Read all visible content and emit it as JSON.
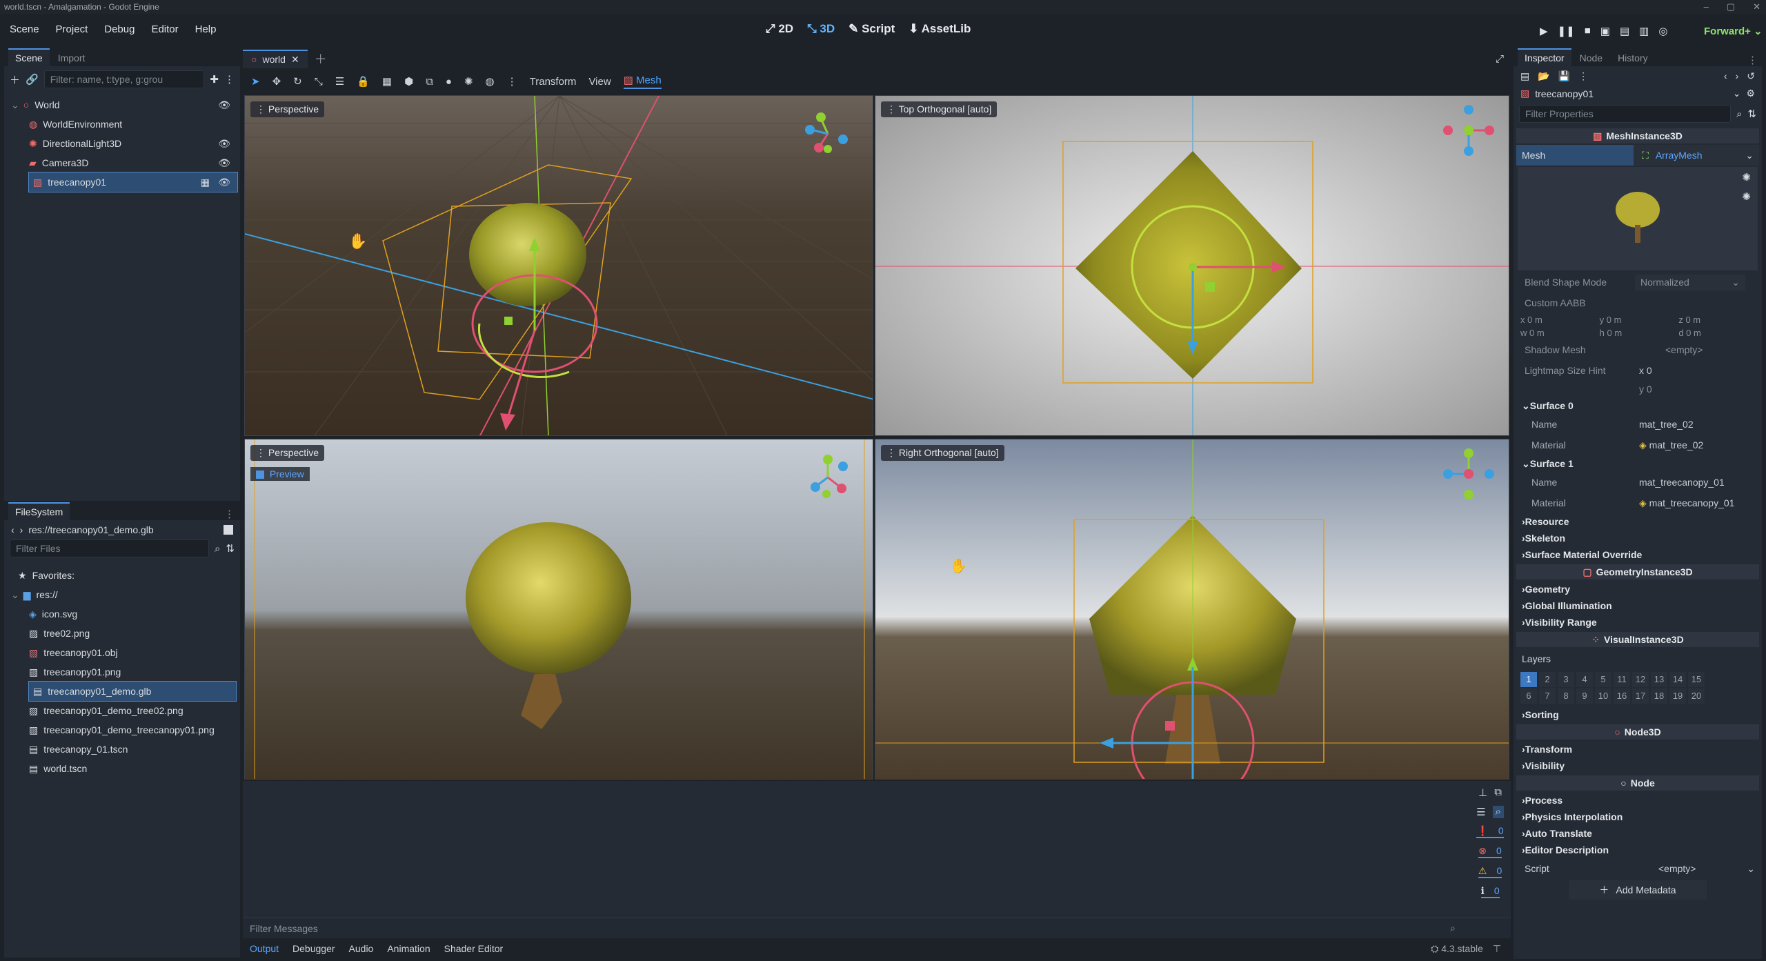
{
  "window": {
    "title": "world.tscn - Amalgamation - Godot Engine"
  },
  "menubar": {
    "menus": [
      "Scene",
      "Project",
      "Debug",
      "Editor",
      "Help"
    ],
    "workspaces": [
      "2D",
      "3D",
      "Script",
      "AssetLib"
    ],
    "active_workspace": "3D",
    "renderer": "Forward+"
  },
  "scene_dock": {
    "tabs": [
      "Scene",
      "Import"
    ],
    "filter_placeholder": "Filter: name, t:type, g:grou",
    "nodes": [
      {
        "name": "World",
        "icon": "node3d-icon",
        "depth": 0,
        "visible_toggle": true
      },
      {
        "name": "WorldEnvironment",
        "icon": "world-environment-icon",
        "depth": 1,
        "visible_toggle": false
      },
      {
        "name": "DirectionalLight3D",
        "icon": "light-icon",
        "depth": 1,
        "visible_toggle": true
      },
      {
        "name": "Camera3D",
        "icon": "camera-icon",
        "depth": 1,
        "visible_toggle": true
      },
      {
        "name": "treecanopy01",
        "icon": "mesh-instance-icon",
        "depth": 1,
        "visible_toggle": true,
        "selected": true
      }
    ]
  },
  "filesystem": {
    "tab": "FileSystem",
    "path": "res://treecanopy01_demo.glb",
    "filter_placeholder": "Filter Files",
    "favorites_label": "Favorites:",
    "root_label": "res://",
    "files": [
      {
        "name": "icon.svg",
        "icon": "svg-file-icon"
      },
      {
        "name": "tree02.png",
        "icon": "image-file-icon"
      },
      {
        "name": "treecanopy01.obj",
        "icon": "mesh-file-icon"
      },
      {
        "name": "treecanopy01.png",
        "icon": "image-file-icon"
      },
      {
        "name": "treecanopy01_demo.glb",
        "icon": "scene-file-icon",
        "selected": true
      },
      {
        "name": "treecanopy01_demo_tree02.png",
        "icon": "image-file-icon"
      },
      {
        "name": "treecanopy01_demo_treecanopy01.png",
        "icon": "image-file-icon"
      },
      {
        "name": "treecanopy_01.tscn",
        "icon": "scene-file-icon"
      },
      {
        "name": "world.tscn",
        "icon": "scene-file-icon"
      }
    ]
  },
  "editor": {
    "tab": "world",
    "toolbar": {
      "transform": "Transform",
      "view": "View",
      "mesh": "Mesh"
    },
    "viewports": [
      {
        "label": "Perspective"
      },
      {
        "label": "Top Orthogonal [auto]"
      },
      {
        "label": "Perspective",
        "preview": "Preview"
      },
      {
        "label": "Right Orthogonal [auto]"
      }
    ]
  },
  "bottom_panel": {
    "filter_placeholder": "Filter Messages",
    "tabs": [
      "Output",
      "Debugger",
      "Audio",
      "Animation",
      "Shader Editor"
    ],
    "active_tab": "Output",
    "counts": [
      "0",
      "0",
      "0",
      "0"
    ],
    "version": "4.3.stable"
  },
  "inspector": {
    "tabs": [
      "Inspector",
      "Node",
      "History"
    ],
    "object": "treecanopy01",
    "filter_placeholder": "Filter Properties",
    "class_mesh": "MeshInstance3D",
    "mesh_label": "Mesh",
    "mesh_value": "ArrayMesh",
    "blend_label": "Blend Shape Mode",
    "blend_value": "Normalized",
    "custom_aabb": "Custom AABB",
    "aabb": {
      "x": "0 m",
      "y": "0 m",
      "z": "0 m",
      "w": "0 m",
      "h": "0 m",
      "d": "0 m"
    },
    "shadow_label": "Shadow Mesh",
    "shadow_value": "<empty>",
    "lightmap_label": "Lightmap Size Hint",
    "lightmap_x": "0",
    "lightmap_y": "0",
    "surface0": {
      "title": "Surface 0",
      "name_label": "Name",
      "name": "mat_tree_02",
      "material_label": "Material",
      "material": "mat_tree_02"
    },
    "surface1": {
      "title": "Surface 1",
      "name_label": "Name",
      "name": "mat_treecanopy_01",
      "material_label": "Material",
      "material": "mat_treecanopy_01"
    },
    "resource": "Resource",
    "skeleton": "Skeleton",
    "surface_override": "Surface Material Override",
    "class_geometry": "GeometryInstance3D",
    "geometry": "Geometry",
    "gi": "Global Illumination",
    "vis_range": "Visibility Range",
    "class_visual": "VisualInstance3D",
    "layers_label": "Layers",
    "layers_top": [
      "1",
      "2",
      "3",
      "4",
      "5",
      "11",
      "12",
      "13",
      "14",
      "15"
    ],
    "layers_bottom": [
      "6",
      "7",
      "8",
      "9",
      "10",
      "16",
      "17",
      "18",
      "19",
      "20"
    ],
    "sorting": "Sorting",
    "class_node3d": "Node3D",
    "transform": "Transform",
    "visibility": "Visibility",
    "class_node": "Node",
    "process": "Process",
    "physics": "Physics Interpolation",
    "auto_translate": "Auto Translate",
    "editor_desc": "Editor Description",
    "script_label": "Script",
    "script_value": "<empty>",
    "add_metadata": "Add Metadata"
  }
}
